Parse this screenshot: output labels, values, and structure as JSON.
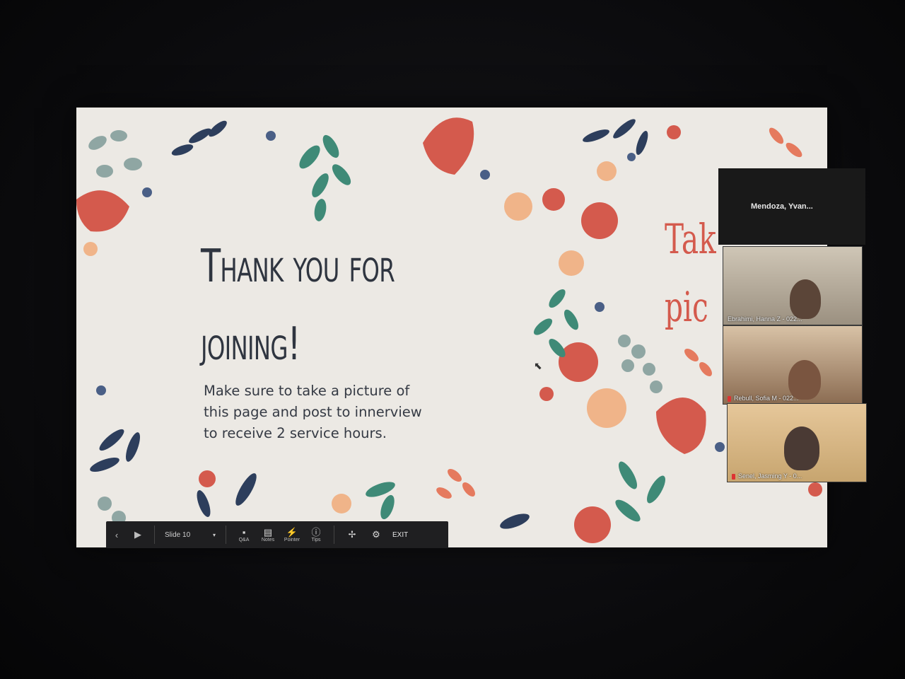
{
  "slide": {
    "title_line1": "Thank you for",
    "title_line2": "joining!",
    "body": "Make sure to take a picture of this page and post to innerview to receive 2 service hours.",
    "next_slide_peek_line1": "Tak",
    "next_slide_peek_line2": "pic",
    "colors": {
      "accent_red": "#d45a4d",
      "leaf_teal": "#3f8a77",
      "navy": "#2d3e5c",
      "peach": "#f0b489",
      "background": "#ece9e4"
    }
  },
  "toolbar": {
    "prev_icon": "chevron-left-icon",
    "next_icon": "play-icon",
    "slide_label": "Slide 10",
    "qa_label": "Q&A",
    "notes_label": "Notes",
    "pointer_label": "Pointer",
    "tips_label": "Tips",
    "exit_label": "EXIT"
  },
  "video_panel": {
    "top_name": "Mendoza,  Yvan...",
    "participants": [
      {
        "name": "Ebrahimi, Hanna Z - 022..."
      },
      {
        "name": "Rebull, Sofia M - 022..."
      },
      {
        "name": "Senel, Jasming Y - 0..."
      }
    ]
  }
}
